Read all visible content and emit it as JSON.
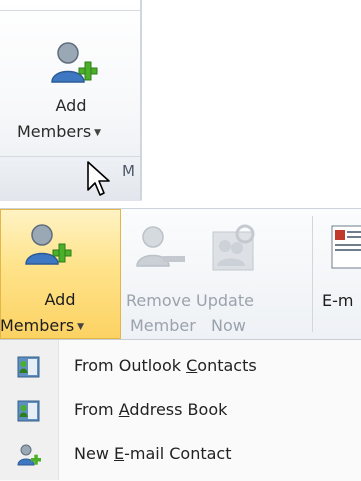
{
  "top_group": {
    "add_members_line1": "Add",
    "add_members_line2": "Members",
    "group_label_partial": "M"
  },
  "ribbon": {
    "add_members": {
      "line1": "Add",
      "line2": "Members",
      "state": "hovered"
    },
    "remove_member": {
      "line1": "Remove",
      "line2": "Member",
      "state": "disabled"
    },
    "update_now": {
      "line1": "Update",
      "line2": "Now",
      "state": "disabled"
    },
    "email_partial": {
      "line1": "E-m"
    }
  },
  "menu": {
    "items": [
      {
        "pre": "From Outlook ",
        "accel": "C",
        "post": "ontacts",
        "icon": "address-book-icon"
      },
      {
        "pre": "From ",
        "accel": "A",
        "post": "ddress Book",
        "icon": "address-book-icon"
      },
      {
        "pre": "New ",
        "accel": "E",
        "post": "-mail Contact",
        "icon": "add-person-icon"
      }
    ]
  },
  "colors": {
    "hover_fill": "#ffe38a",
    "hover_border": "#e3b648",
    "plus_green": "#4caf2a",
    "disabled_text": "#9aa3ad"
  }
}
